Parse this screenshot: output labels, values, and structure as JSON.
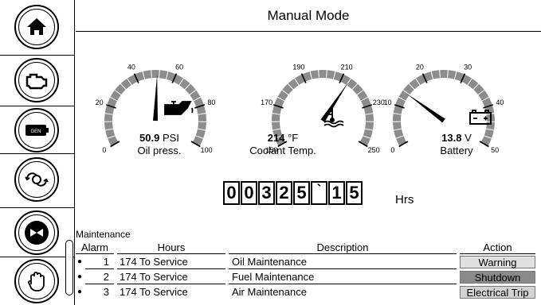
{
  "title": "Manual Mode",
  "sidebar": {
    "buttons": [
      {
        "name": "home-button",
        "icon": "home-icon"
      },
      {
        "name": "engine-button",
        "icon": "engine-icon"
      },
      {
        "name": "generator-button",
        "icon": "generator-icon"
      },
      {
        "name": "cycle-button",
        "icon": "cycle-icon"
      },
      {
        "name": "horn-silence-button",
        "icon": "horn-off-icon"
      },
      {
        "name": "stop-button",
        "icon": "hand-stop-icon"
      }
    ],
    "gen_label": "GEN"
  },
  "gauges": [
    {
      "name": "oil-pressure",
      "ticks": [
        "0",
        "20",
        "40",
        "60",
        "80",
        "100"
      ],
      "min": 0,
      "max": 100,
      "value": 50.9,
      "value_text": "50.9",
      "unit": "PSI",
      "label": "Oil press.",
      "icon": "oil-can-icon"
    },
    {
      "name": "coolant-temp",
      "ticks": [
        "150",
        "170",
        "190",
        "210",
        "230",
        "250"
      ],
      "min": 150,
      "max": 250,
      "value": 214,
      "value_text": "214",
      "unit": "°F",
      "label": "Coolant Temp.",
      "icon": "thermometer-icon"
    },
    {
      "name": "battery",
      "ticks": [
        "0",
        "10",
        "20",
        "30",
        "40",
        "50"
      ],
      "min": 0,
      "max": 50,
      "value": 13.8,
      "value_text": "13.8",
      "unit": "V",
      "label": "Battery",
      "icon": "battery-icon"
    }
  ],
  "hour_meter": {
    "digits": [
      "0",
      "0",
      "3",
      "2",
      "5"
    ],
    "separator": "`",
    "fraction": [
      "1",
      "5"
    ],
    "unit": "Hrs"
  },
  "maintenance": {
    "title": "Maintenance",
    "headers": {
      "alarm": "Alarm",
      "hours": "Hours",
      "description": "Description",
      "action": "Action"
    },
    "rows": [
      {
        "alarm": "1",
        "hours": "174 To Service",
        "description": "Oil Maintenance",
        "action": "Warning"
      },
      {
        "alarm": "2",
        "hours": "174 To Service",
        "description": "Fuel Maintenance",
        "action": "Shutdown"
      },
      {
        "alarm": "3",
        "hours": "174 To Service",
        "description": "Air Maintenance",
        "action": "Electrical Trip"
      }
    ],
    "action_colors": {
      "Warning": "#e0e0e0",
      "Shutdown": "#8a8a8a",
      "Electrical Trip": "#d2d2d2"
    }
  }
}
